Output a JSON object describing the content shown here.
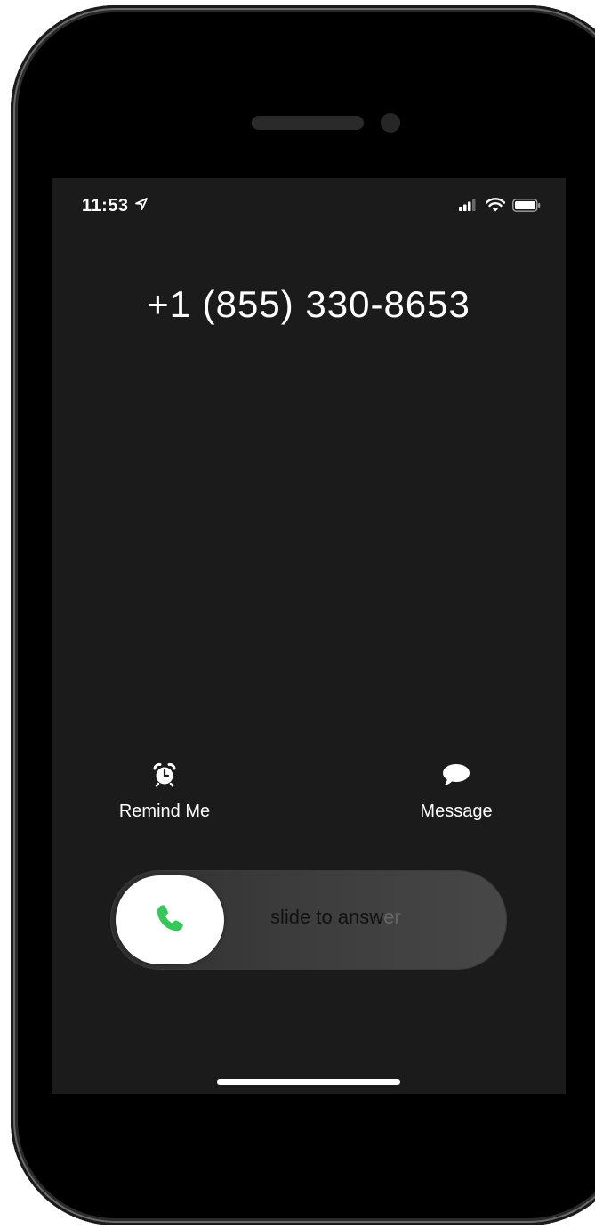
{
  "status_bar": {
    "time": "11:53",
    "location_icon": "location-arrow-icon",
    "signal_icon": "cellular-signal-icon",
    "wifi_icon": "wifi-icon",
    "battery_icon": "battery-icon"
  },
  "call": {
    "caller": "+1 (855) 330-8653"
  },
  "actions": {
    "remind": {
      "label": "Remind Me",
      "icon": "alarm-clock-icon"
    },
    "message": {
      "label": "Message",
      "icon": "message-bubble-icon"
    }
  },
  "slider": {
    "label_main": "slide to answ",
    "label_fade": "er",
    "knob_icon": "phone-icon",
    "knob_color": "#34c759"
  },
  "colors": {
    "screen_bg": "#1b1b1b",
    "frame": "#000000"
  }
}
